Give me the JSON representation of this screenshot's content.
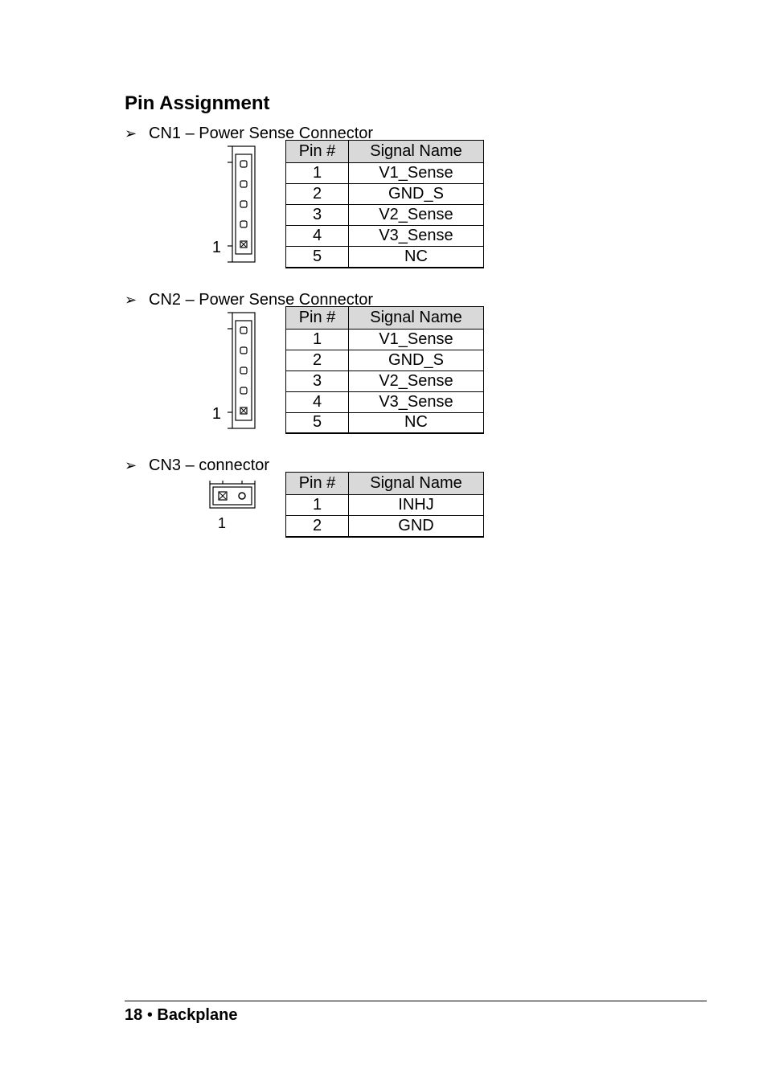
{
  "section_title": "Pin Assignment",
  "connectors": [
    {
      "heading": "CN1 – Power Sense Connector",
      "headers": {
        "pin": "Pin #",
        "signal": "Signal Name"
      },
      "pin_label": "1",
      "rows": [
        {
          "pin": "1",
          "signal": "V1_Sense"
        },
        {
          "pin": "2",
          "signal": "GND_S"
        },
        {
          "pin": "3",
          "signal": "V2_Sense"
        },
        {
          "pin": "4",
          "signal": "V3_Sense"
        },
        {
          "pin": "5",
          "signal": "NC"
        }
      ]
    },
    {
      "heading": "CN2 – Power Sense Connector",
      "headers": {
        "pin": "Pin #",
        "signal": "Signal Name"
      },
      "pin_label": "1",
      "rows": [
        {
          "pin": "1",
          "signal": "V1_Sense"
        },
        {
          "pin": "2",
          "signal": "GND_S"
        },
        {
          "pin": "3",
          "signal": "V2_Sense"
        },
        {
          "pin": "4",
          "signal": "V3_Sense"
        },
        {
          "pin": "5",
          "signal": "NC"
        }
      ]
    },
    {
      "heading": "CN3 – connector",
      "headers": {
        "pin": "Pin #",
        "signal": "Signal Name"
      },
      "pin_label": "1",
      "rows": [
        {
          "pin": "1",
          "signal": "INHJ"
        },
        {
          "pin": "2",
          "signal": "GND"
        }
      ]
    }
  ],
  "footer": {
    "page": "18",
    "separator": "•",
    "section": "Backplane"
  }
}
